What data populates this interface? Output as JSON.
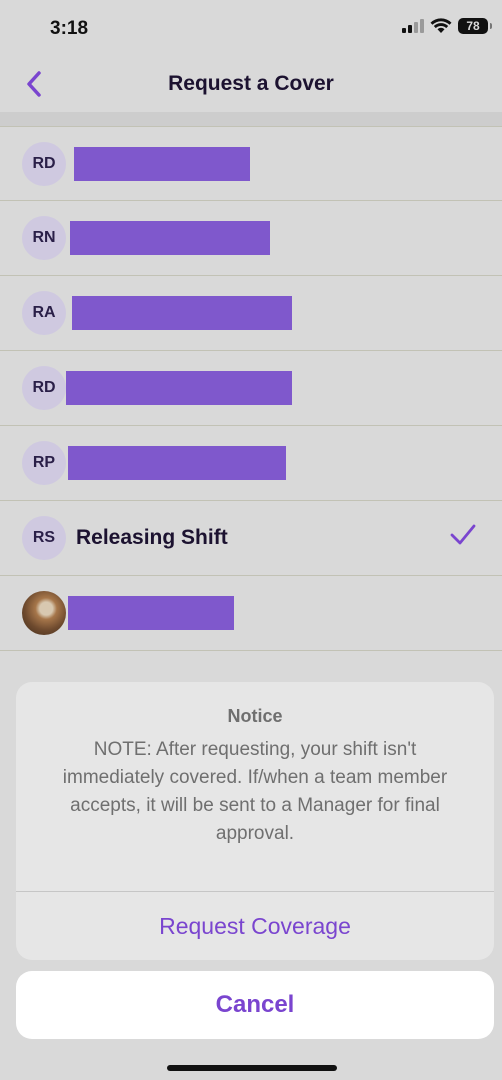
{
  "status_bar": {
    "time": "3:18",
    "battery": "78"
  },
  "nav": {
    "title": "Request a Cover"
  },
  "list": [
    {
      "initials": "RD",
      "redacted": true
    },
    {
      "initials": "RN",
      "redacted": true
    },
    {
      "initials": "RA",
      "redacted": true
    },
    {
      "initials": "RD",
      "redacted": true
    },
    {
      "initials": "RP",
      "redacted": true
    },
    {
      "initials": "RS",
      "name": "Releasing Shift",
      "selected": true
    },
    {
      "initials": "",
      "photo": true,
      "redacted": true
    }
  ],
  "sheet": {
    "title": "Notice",
    "message": "NOTE: After requesting, your shift isn't immediately covered. If/when a team member accepts, it will be sent to a Manager for final approval.",
    "request_label": "Request Coverage",
    "cancel_label": "Cancel"
  },
  "colors": {
    "accent": "#7a45cf",
    "redaction": "#7f58cc"
  }
}
